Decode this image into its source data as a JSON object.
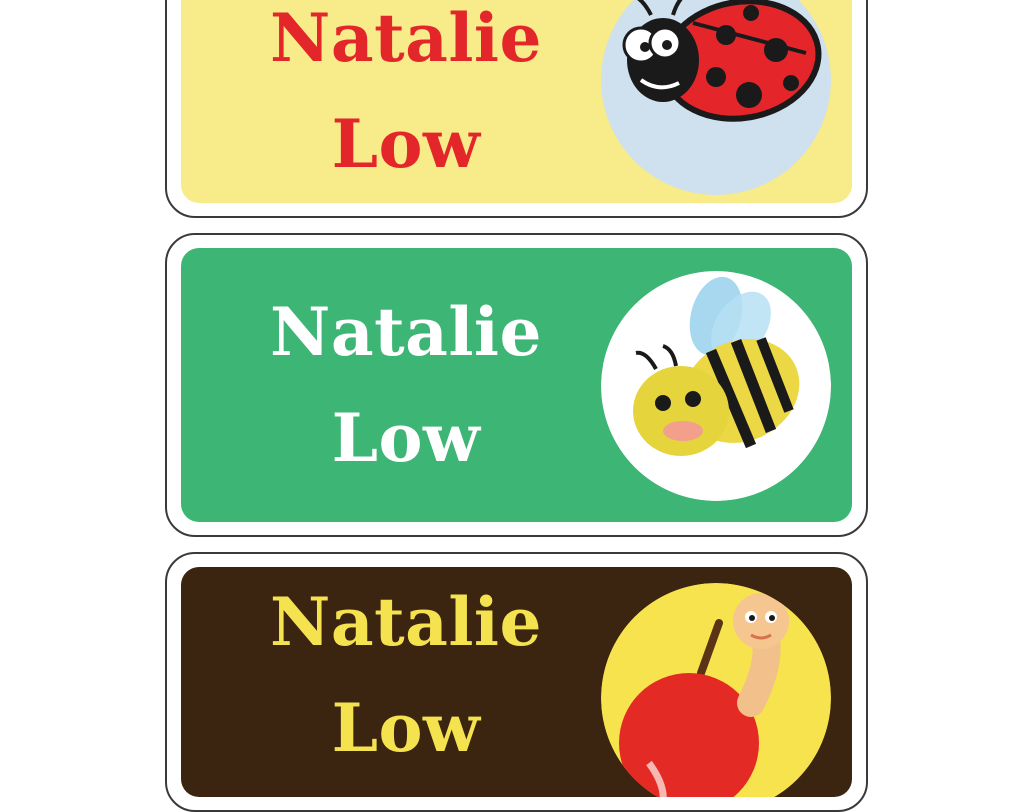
{
  "labels": [
    {
      "first_name": "Natalie",
      "last_name": "Low",
      "background": "#f8eb8a",
      "text_color": "#e3262a",
      "icon": "ladybug-icon",
      "icon_bg": "#cfe0ee"
    },
    {
      "first_name": "Natalie",
      "last_name": "Low",
      "background": "#3db574",
      "text_color": "#ffffff",
      "icon": "bee-icon",
      "icon_bg": "#ffffff"
    },
    {
      "first_name": "Natalie",
      "last_name": "Low",
      "background": "#3b2410",
      "text_color": "#f4e34f",
      "icon": "apple-worm-icon",
      "icon_bg": "#f6e34e"
    }
  ]
}
